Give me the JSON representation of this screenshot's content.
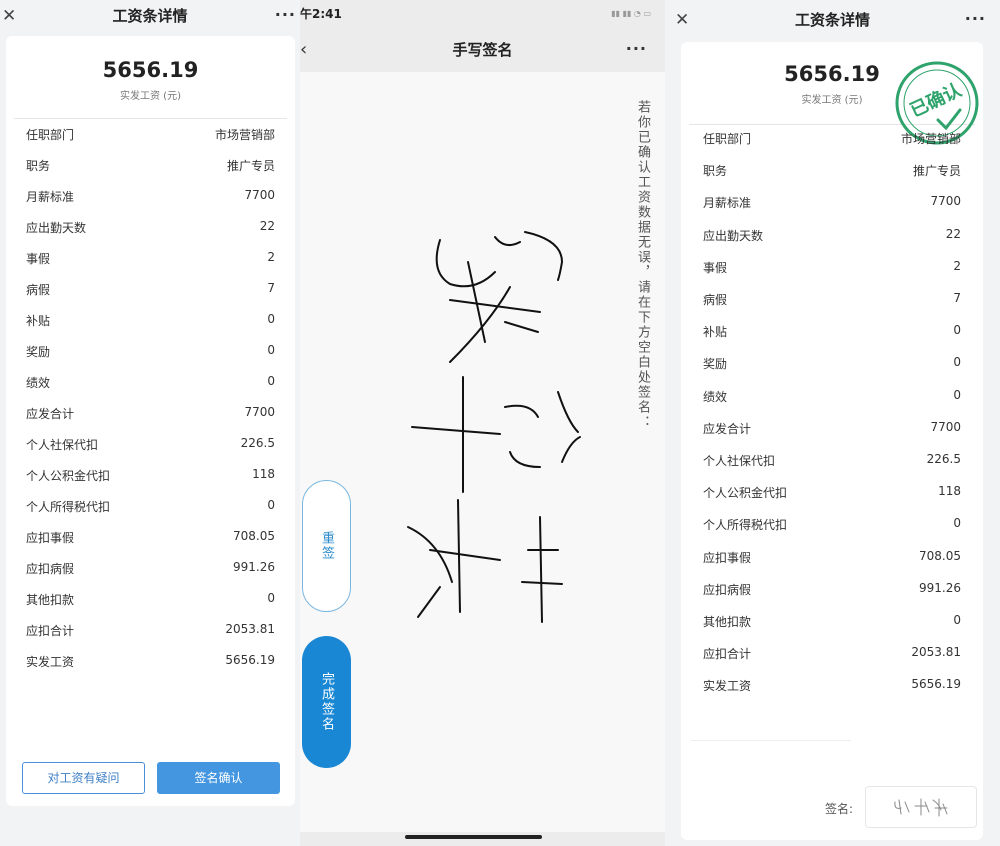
{
  "left": {
    "header": {
      "title": "工资条详情",
      "close_icon": "close-icon",
      "more_icon": "more-icon"
    },
    "amount": "5656.19",
    "amount_label": "实发工资 (元)",
    "rows": [
      {
        "label": "任职部门",
        "value": "市场营销部"
      },
      {
        "label": "职务",
        "value": "推广专员"
      },
      {
        "label": "月薪标准",
        "value": "7700"
      },
      {
        "label": "应出勤天数",
        "value": "22"
      },
      {
        "label": "事假",
        "value": "2"
      },
      {
        "label": "病假",
        "value": "7"
      },
      {
        "label": "补贴",
        "value": "0"
      },
      {
        "label": "奖励",
        "value": "0"
      },
      {
        "label": "绩效",
        "value": "0"
      },
      {
        "label": "应发合计",
        "value": "7700"
      },
      {
        "label": "个人社保代扣",
        "value": "226.5"
      },
      {
        "label": "个人公积金代扣",
        "value": "118"
      },
      {
        "label": "个人所得税代扣",
        "value": "0"
      },
      {
        "label": "应扣事假",
        "value": "708.05"
      },
      {
        "label": "应扣病假",
        "value": "991.26"
      },
      {
        "label": "其他扣款",
        "value": "0"
      },
      {
        "label": "应扣合计",
        "value": "2053.81"
      },
      {
        "label": "实发工资",
        "value": "5656.19"
      }
    ],
    "buttons": {
      "question": "对工资有疑问",
      "confirm": "签名确认"
    }
  },
  "middle": {
    "status_time": "午2:41",
    "header": {
      "title": "手写签名",
      "back_icon": "back-icon",
      "more_icon": "more-icon"
    },
    "instruction": "若你已确认工资数据无误，请在下方空白处签名：",
    "buttons": {
      "resign": "重签",
      "finish": "完成签名"
    }
  },
  "right": {
    "header": {
      "title": "工资条详情",
      "close_icon": "close-icon",
      "more_icon": "more-icon"
    },
    "amount": "5656.19",
    "amount_label": "实发工资 (元)",
    "stamp_text": "已确认",
    "rows": [
      {
        "label": "任职部门",
        "value": "市场营销部"
      },
      {
        "label": "职务",
        "value": "推广专员"
      },
      {
        "label": "月薪标准",
        "value": "7700"
      },
      {
        "label": "应出勤天数",
        "value": "22"
      },
      {
        "label": "事假",
        "value": "2"
      },
      {
        "label": "病假",
        "value": "7"
      },
      {
        "label": "补贴",
        "value": "0"
      },
      {
        "label": "奖励",
        "value": "0"
      },
      {
        "label": "绩效",
        "value": "0"
      },
      {
        "label": "应发合计",
        "value": "7700"
      },
      {
        "label": "个人社保代扣",
        "value": "226.5"
      },
      {
        "label": "个人公积金代扣",
        "value": "118"
      },
      {
        "label": "个人所得税代扣",
        "value": "0"
      },
      {
        "label": "应扣事假",
        "value": "708.05"
      },
      {
        "label": "应扣病假",
        "value": "991.26"
      },
      {
        "label": "其他扣款",
        "value": "0"
      },
      {
        "label": "应扣合计",
        "value": "2053.81"
      },
      {
        "label": "实发工资",
        "value": "5656.19"
      }
    ],
    "signature_label": "签名:"
  },
  "colors": {
    "accent": "#4496e0",
    "stamp": "#2ea36b",
    "page_bg": "#f2f3f5"
  }
}
